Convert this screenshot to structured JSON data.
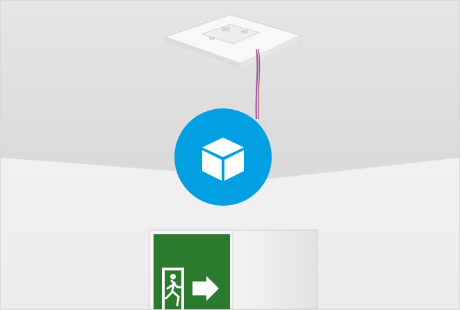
{
  "viewer": {
    "play_button_icon": "cube-3d-icon",
    "accent_color": "#039fe3"
  },
  "scene": {
    "ceiling_mount_icon": "ceiling-mount-plate",
    "exit_sign_icon": "running-man-exit-arrow-right",
    "exit_sign_color": "#2b7a2e"
  }
}
